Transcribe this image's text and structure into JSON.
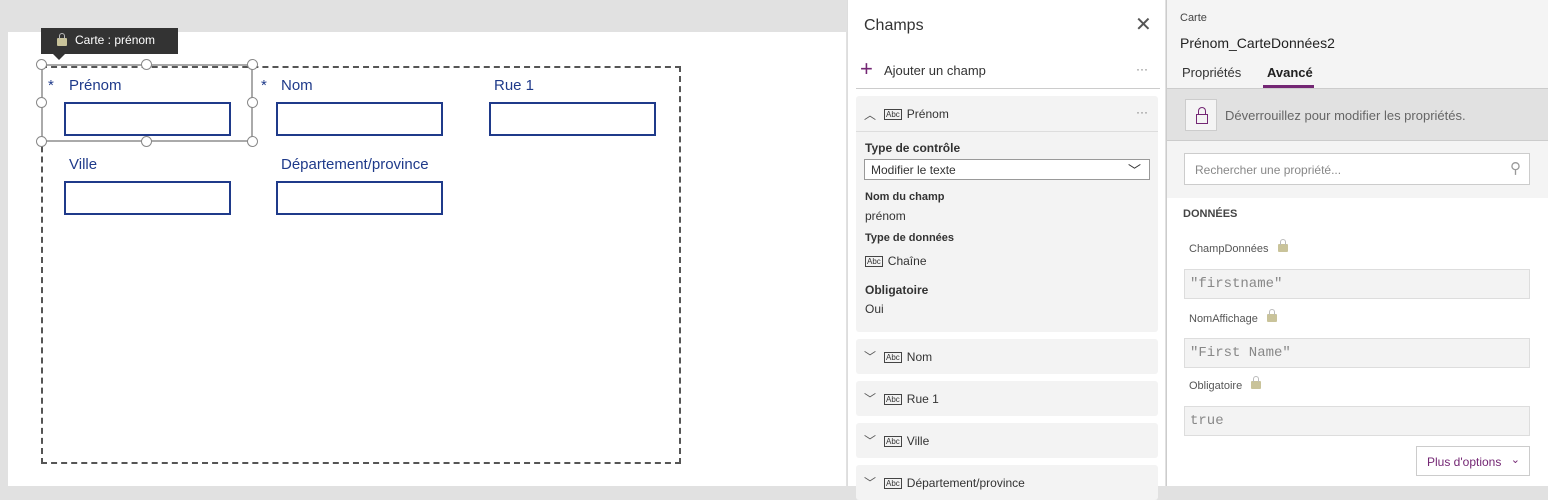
{
  "canvas": {
    "tooltip": "Carte : prénom",
    "fields": [
      {
        "label": "Prénom",
        "required": "*"
      },
      {
        "label": "Nom",
        "required": "*"
      },
      {
        "label": "Rue 1"
      },
      {
        "label": "Ville"
      },
      {
        "label": "Département/province"
      }
    ]
  },
  "fields_panel": {
    "title": "Champs",
    "add_field": "Ajouter un champ",
    "more": "···",
    "expanded": {
      "name": "Prénom",
      "icon": "Abc",
      "control_type_label": "Type de contrôle",
      "control_type_value": "Modifier le texte",
      "field_name_label": "Nom du champ",
      "field_name_value": "prénom",
      "data_type_label": "Type de données",
      "data_type_value": "Chaîne",
      "required_label": "Obligatoire",
      "required_value": "Oui"
    },
    "collapsed": [
      "Nom",
      "Rue 1",
      "Ville",
      "Département/province"
    ]
  },
  "properties": {
    "kind": "Carte",
    "name": "Prénom_CarteDonnées2",
    "tabs": [
      "Propriétés",
      "Avancé"
    ],
    "unlock_message": "Déverrouillez pour modifier les propriétés.",
    "search_placeholder": "Rechercher une propriété...",
    "section": "DONNÉES",
    "props": [
      {
        "label": "ChampDonnées",
        "value": "\"firstname\""
      },
      {
        "label": "NomAffichage",
        "value": "\"First Name\""
      },
      {
        "label": "Obligatoire",
        "value": "true"
      }
    ],
    "more_options": "Plus d'options"
  },
  "colors": {
    "accent": "#742774",
    "field": "#1f3a8a"
  }
}
